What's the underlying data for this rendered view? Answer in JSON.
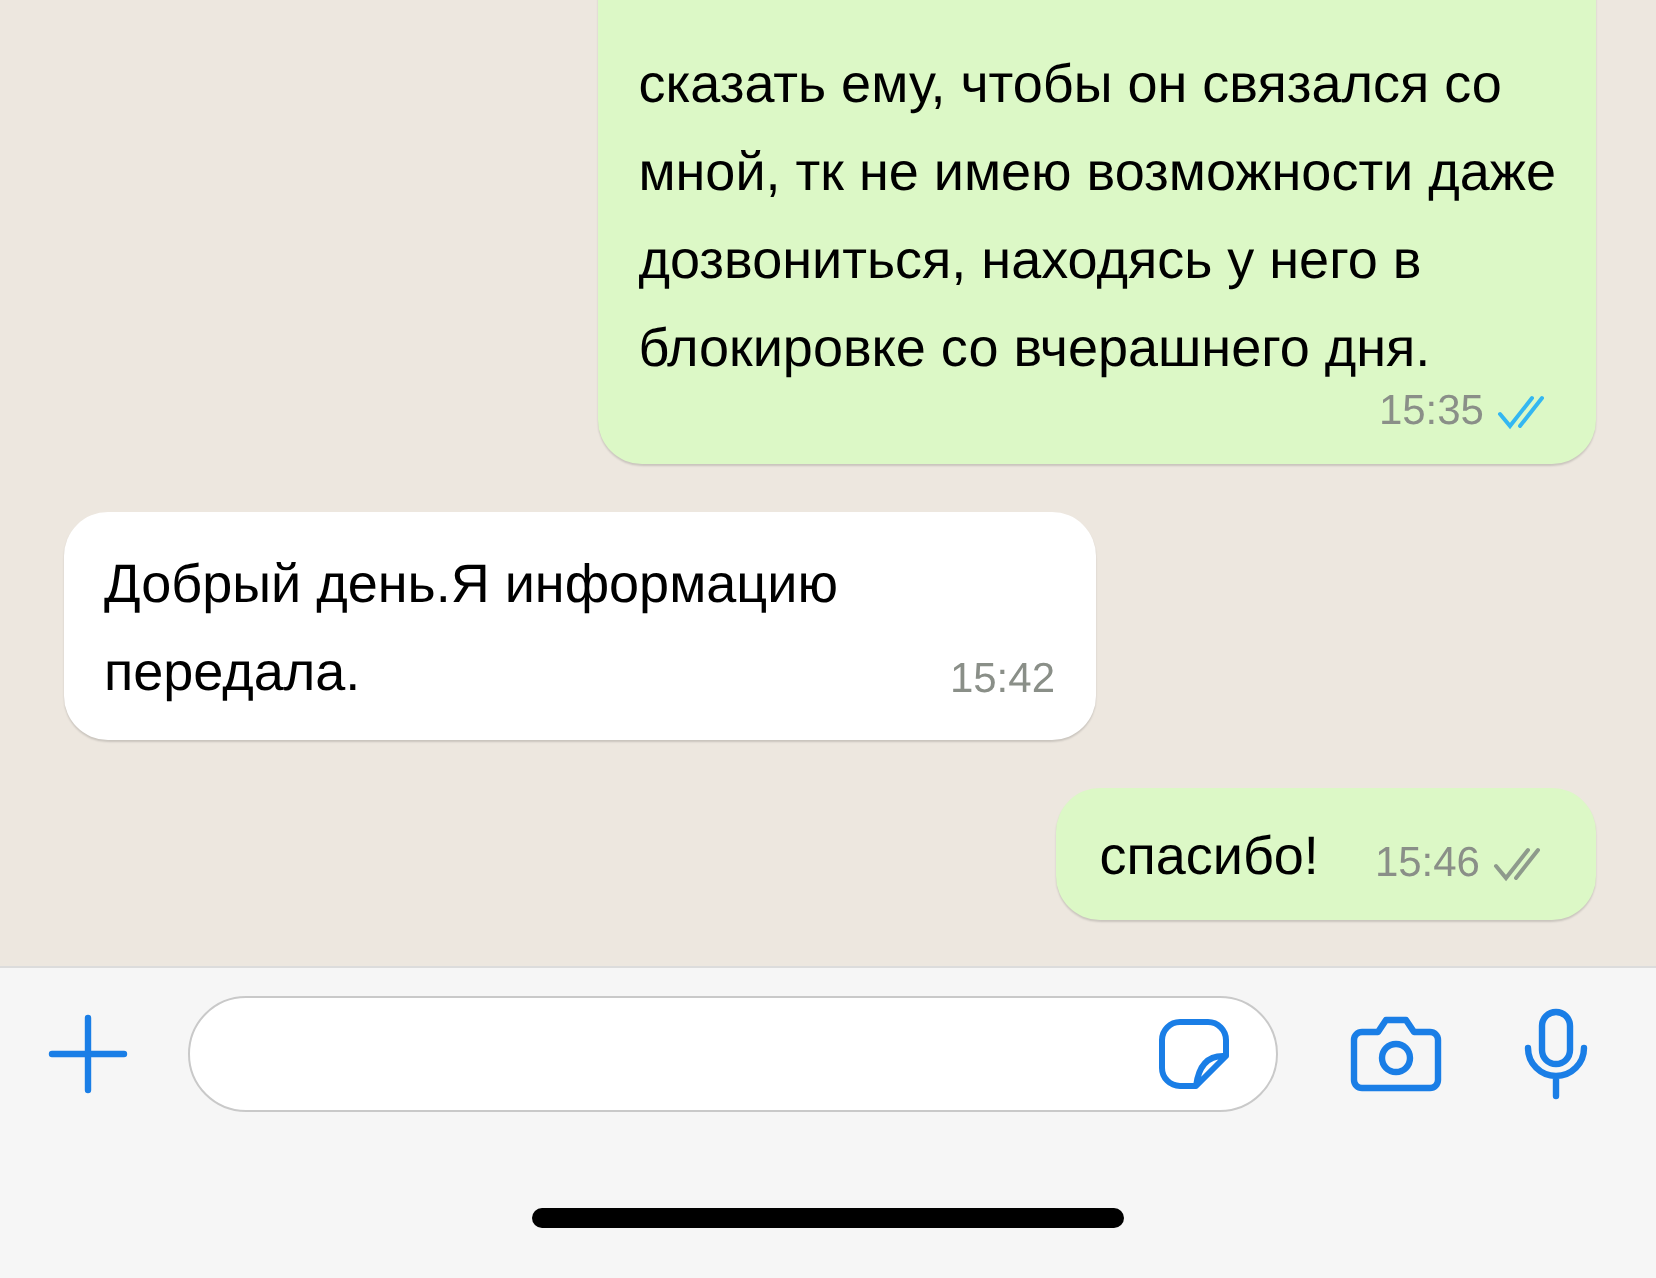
{
  "messages": [
    {
      "outgoing": true,
      "text": "сказать ему, чтобы он связался со\nмной, тк не имею возможности даже\nдозвониться, находясь у него в\nблокировке со вчерашнего дня.",
      "time": "15:35",
      "read": true,
      "continued": true
    },
    {
      "outgoing": false,
      "text": "Добрый день.Я информацию\nпередала.",
      "time": "15:42",
      "continued": false
    },
    {
      "outgoing": true,
      "text": "спасибо!",
      "time": "15:46",
      "read": false,
      "continued": false
    }
  ]
}
